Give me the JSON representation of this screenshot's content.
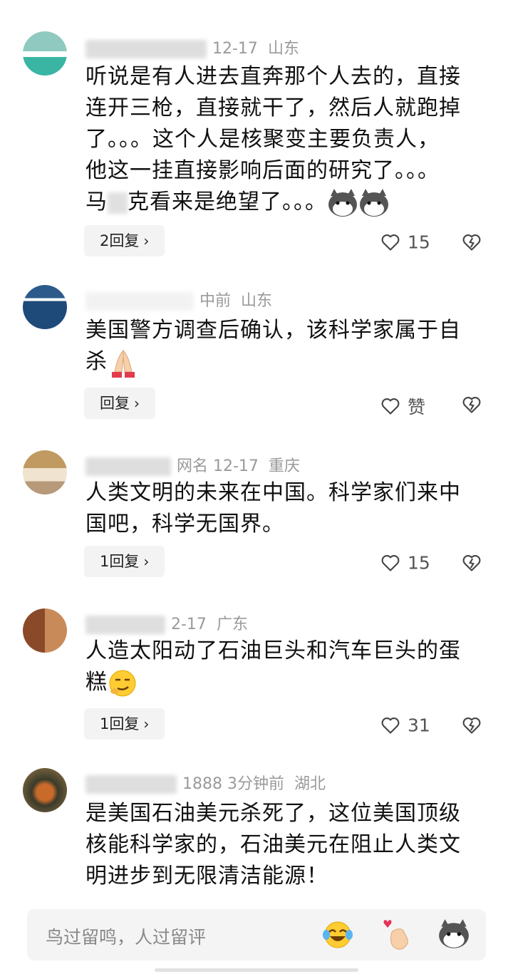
{
  "comments": [
    {
      "meta": "12-17",
      "region": "山东",
      "lines": [
        "听说是有人进去直奔那个人去的，直接",
        "连开三枪，直接就干了，然后人就跑掉",
        "了。。。这个人是核聚变主要负责人，",
        "他这一挂直接影响后面的研究了。。。",
        "马",
        "克看来是绝望了。。。"
      ],
      "reply": "2回复",
      "likes": "15"
    },
    {
      "meta": "中前",
      "region": "山东",
      "lines": [
        "美国警方调查后确认，该科学家属于自",
        "杀"
      ],
      "reply": "回复",
      "likes": "赞"
    },
    {
      "meta": "网名  12-17",
      "region": "重庆",
      "lines": [
        "人类文明的未来在中国。科学家们来中",
        "国吧，科学无国界。"
      ],
      "reply": "1回复",
      "likes": "15"
    },
    {
      "meta": "2-17",
      "region": "广东",
      "lines": [
        "人造太阳动了石油巨头和汽车巨头的蛋",
        "糕"
      ],
      "reply": "1回复",
      "likes": "31"
    },
    {
      "meta": "1888  3分钟前",
      "region": "湖北",
      "lines": [
        "是美国石油美元杀死了，这位美国顶级",
        "核能科学家的，石油美元在阻止人类文",
        "明进步到无限清洁能源！"
      ]
    }
  ],
  "input": {
    "placeholder": "鸟过留鸣，人过留评"
  },
  "icons": [
    "heart-icon",
    "broken-heart-icon",
    "chevron-right-icon",
    "husky-emoji",
    "pray-emoji",
    "smirk-emoji",
    "laugh-cry-emoji",
    "finger-heart-emoji"
  ],
  "colors": {
    "text": "#111111",
    "meta": "#9a9a9a",
    "button_bg": "#f3f3f3",
    "input_bg": "#f4f4f4"
  }
}
